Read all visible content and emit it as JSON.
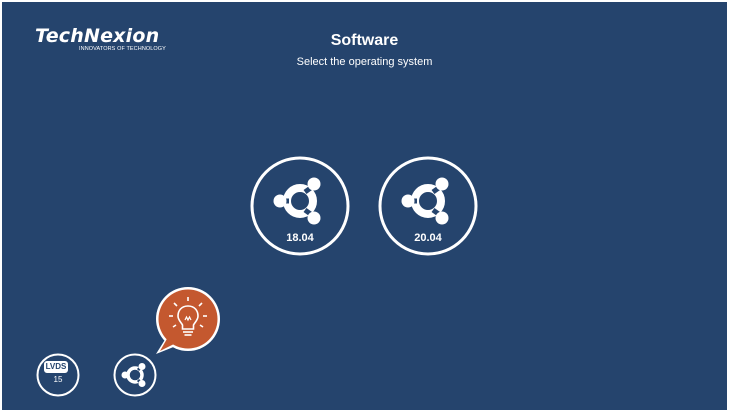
{
  "brand": {
    "name": "TechNexion",
    "tagline": "INNOVATORS OF TECHNOLOGY"
  },
  "header": {
    "title": "Software",
    "subtitle": "Select the operating system"
  },
  "os_options": [
    {
      "label": "18.04",
      "icon": "ubuntu-icon"
    },
    {
      "label": "20.04",
      "icon": "ubuntu-icon"
    }
  ],
  "bottom_bar": {
    "display": {
      "badge": "LVDS",
      "value": "15"
    },
    "os_shortcut": {
      "icon": "ubuntu-icon"
    },
    "tip": {
      "icon": "lightbulb-icon"
    }
  },
  "colors": {
    "background": "#25446d",
    "foreground": "#ffffff",
    "accent": "#c4582f"
  }
}
